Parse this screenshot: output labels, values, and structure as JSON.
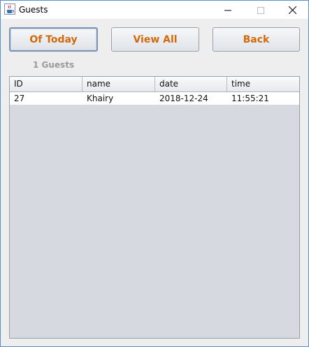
{
  "window": {
    "title": "Guests",
    "icon": "java-cup-icon"
  },
  "toolbar": {
    "today_label": "Of Today",
    "view_all_label": "View All",
    "back_label": "Back"
  },
  "summary": {
    "count_text": "1 Guests"
  },
  "table": {
    "columns": [
      "ID",
      "name",
      "date",
      "time"
    ],
    "rows": [
      [
        "27",
        "Khairy",
        "2018-12-24",
        "11:55:21"
      ]
    ]
  },
  "colors": {
    "button_text": "#d2690b",
    "count_text": "#9a9a9a",
    "table_background": "#d6d9e0"
  }
}
